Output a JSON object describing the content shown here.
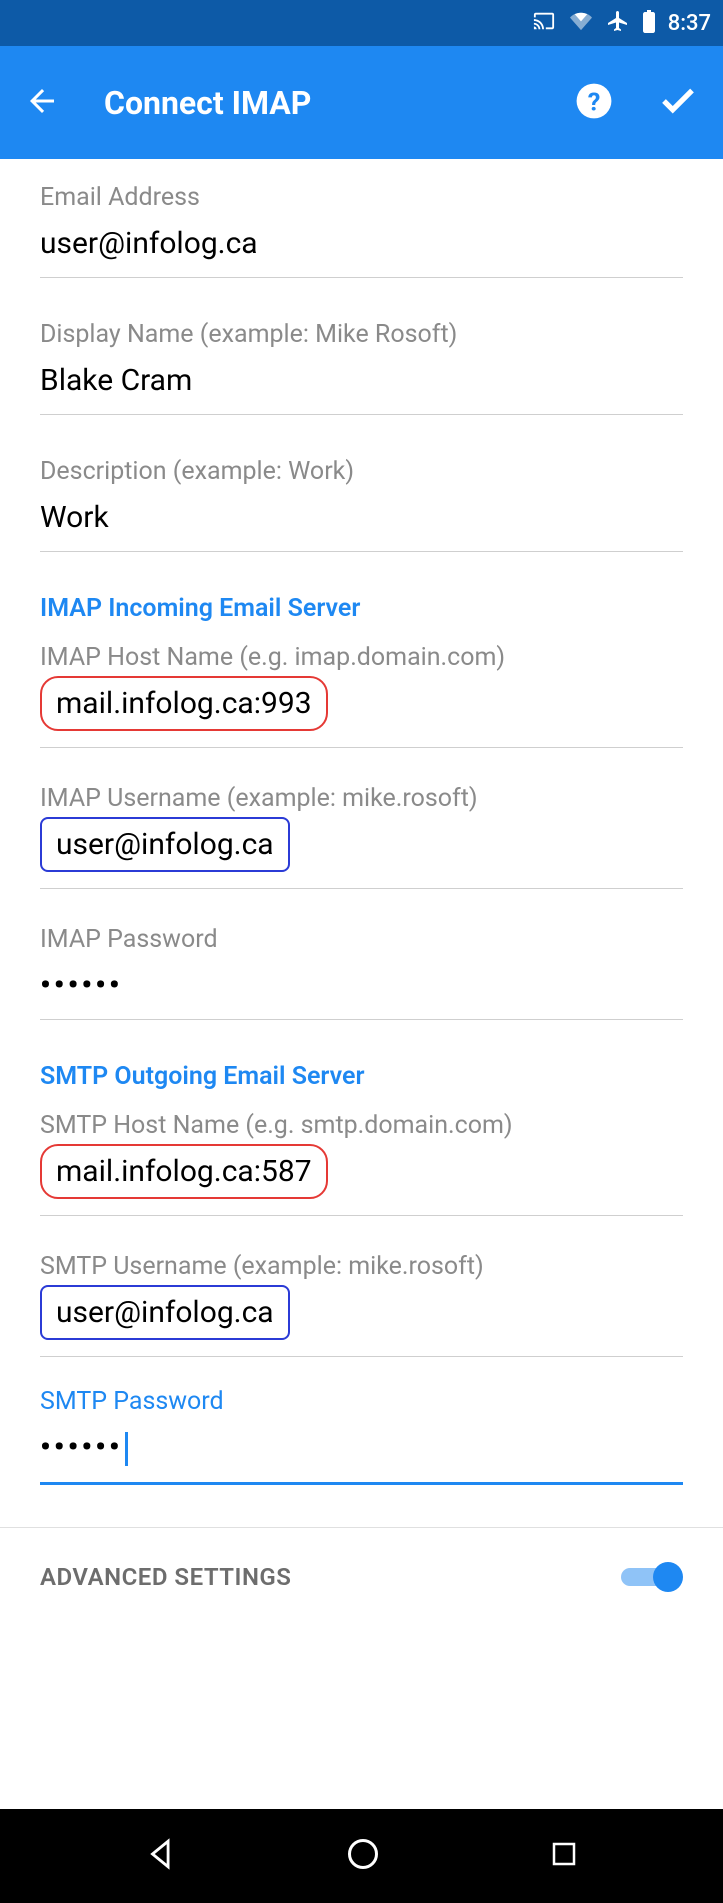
{
  "status": {
    "time": "8:37"
  },
  "appbar": {
    "title": "Connect IMAP"
  },
  "fields": {
    "email": {
      "label": "Email Address",
      "value": "user@infolog.ca"
    },
    "display": {
      "label": "Display Name (example: Mike Rosoft)",
      "value": "Blake Cram"
    },
    "desc": {
      "label": "Description (example: Work)",
      "value": "Work"
    }
  },
  "imap_section": "IMAP Incoming Email Server",
  "imap": {
    "host": {
      "label": "IMAP Host Name (e.g. imap.domain.com)",
      "value": "mail.infolog.ca:993"
    },
    "user": {
      "label": "IMAP Username (example: mike.rosoft)",
      "value": "user@infolog.ca"
    },
    "pass": {
      "label": "IMAP Password",
      "value": "••••••"
    }
  },
  "smtp_section": "SMTP Outgoing Email Server",
  "smtp": {
    "host": {
      "label": "SMTP Host Name (e.g. smtp.domain.com)",
      "value": "mail.infolog.ca:587"
    },
    "user": {
      "label": "SMTP Username (example: mike.rosoft)",
      "value": "user@infolog.ca"
    },
    "pass": {
      "label": "SMTP Password",
      "value": "••••••"
    }
  },
  "advanced": {
    "label": "ADVANCED SETTINGS"
  }
}
